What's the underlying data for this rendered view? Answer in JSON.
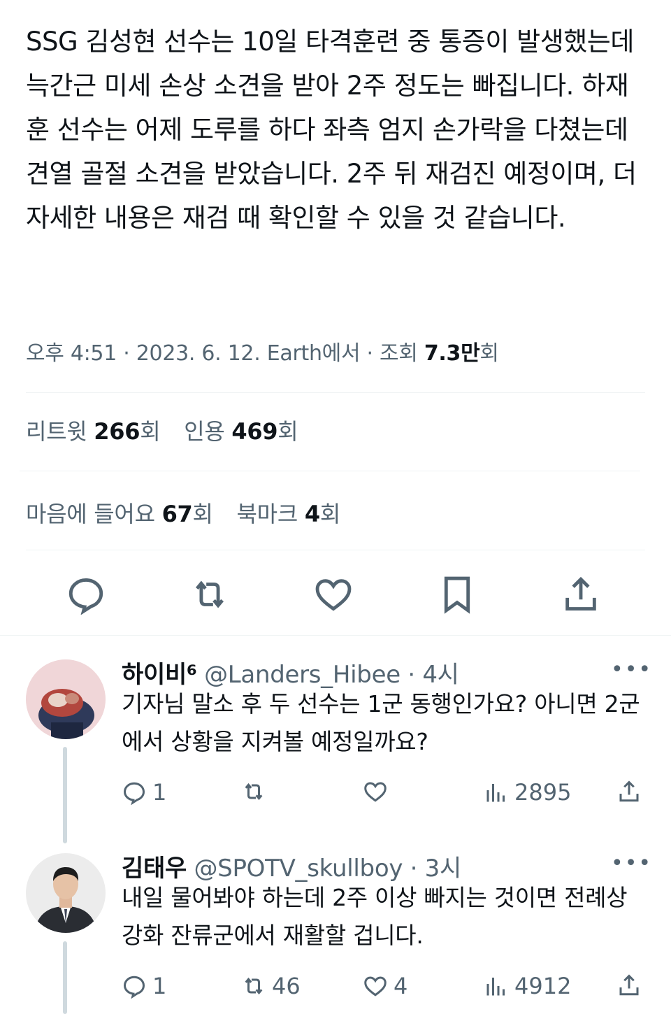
{
  "tweet": {
    "text": "SSG 김성현 선수는 10일 타격훈련 중 통증이 발생했는데 늑간근 미세 손상 소견을 받아 2주 정도는 빠집니다. 하재훈 선수는 어제 도루를 하다 좌측 엄지 손가락을 다쳤는데 견열 골절 소견을 받았습니다. 2주 뒤 재검진 예정이며, 더 자세한 내용은 재검 때 확인할 수 있을 것 같습니다.",
    "time": "오후 4:51",
    "date": "2023. 6. 12.",
    "source": "Earth에서",
    "views_label": "조회",
    "views_value": "7.3만",
    "views_unit": "회"
  },
  "stats": {
    "retweets_label": "리트윗",
    "retweets_value": "266",
    "quotes_label": "인용",
    "quotes_value": "469",
    "likes_label": "마음에 들어요",
    "likes_value": "67",
    "bookmarks_label": "북마크",
    "bookmarks_value": "4",
    "unit": "회"
  },
  "action_icons": [
    "reply-icon",
    "retweet-icon",
    "like-icon",
    "bookmark-icon",
    "share-icon"
  ],
  "replies": [
    {
      "name": "하이비⁶",
      "handle": "@Landers_Hibee",
      "time": "· 4시",
      "text": "기자님 말소 후 두 선수는 1군 동행인가요? 아니면 2군에서 상황을 지켜볼 예정일까요?",
      "reply_count": "1",
      "retweet_count": "",
      "like_count": "",
      "view_count": "2895"
    },
    {
      "name": "김태우",
      "handle": "@SPOTV_skullboy",
      "time": "· 3시",
      "text": "내일 물어봐야 하는데 2주 이상 빠지는 것이면 전례상 강화 잔류군에서 재활할 겁니다.",
      "reply_count": "1",
      "retweet_count": "46",
      "like_count": "4",
      "view_count": "4912"
    }
  ],
  "more_label": "•••",
  "colors": {
    "text": "#0f1419",
    "secondary": "#536471",
    "divider": "#eff3f4",
    "thread": "#cfd9de"
  }
}
